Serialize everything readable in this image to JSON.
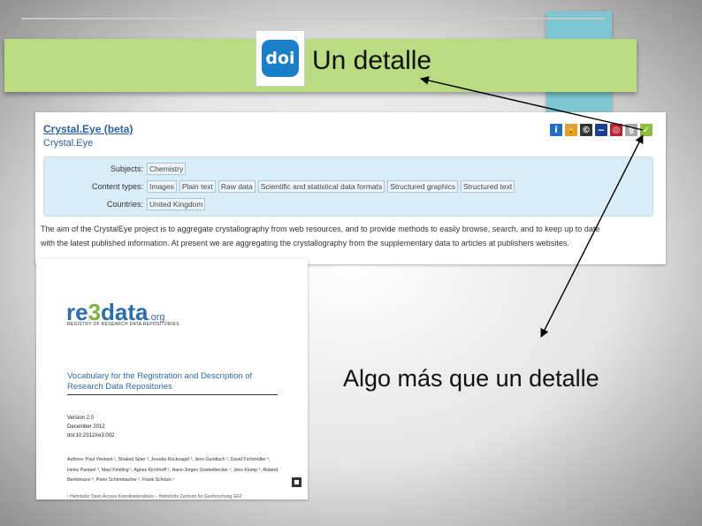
{
  "banner": {
    "logo_text": "doi",
    "title": "Un detalle"
  },
  "repository": {
    "title": "Crystal.Eye (beta)",
    "subtitle": "Crystal.Eye",
    "icons": [
      "info-icon",
      "open-access-icon",
      "copyright-icon",
      "api-icon",
      "policy-icon",
      "certificate-icon",
      "checkmark-icon"
    ],
    "rows": [
      {
        "label": "Subjects:",
        "tags": [
          "Chemistry"
        ]
      },
      {
        "label": "Content types:",
        "tags": [
          "Images",
          "Plain text",
          "Raw data",
          "Scientific and statistical data formats",
          "Structured graphics",
          "Structured text"
        ]
      },
      {
        "label": "Countries:",
        "tags": [
          "United Kingdom"
        ]
      }
    ],
    "description_line1": "The aim of the CrystalEye project is to aggregate crystallography from web resources, and to provide methods to easily browse, search, and to keep up to date",
    "description_line2": "with the latest published information. At present we are aggregating the crystallography from the supplementary data to articles at publishers websites."
  },
  "document": {
    "logo_a": "re",
    "logo_b": "3",
    "logo_c": "data",
    "logo_suffix": ".org",
    "tagline": "REGISTRY OF RESEARCH DATA REPOSITORIES",
    "title": "Vocabulary for the Registration and Description of Research Data Repositories",
    "version": "Version 2.0",
    "date": "December 2012",
    "doi": "doi:10.2312/re3.002",
    "authors": "Authors: Paul Vierkant ¹, Shaked Spier ², Jessika Rücknagel ², Jens Gundlach ¹, David Fichtmüller ³, Heinz Pampel ⁴, Maxi Kindling ¹, Agnes Kirchhoff ⁵, Hans-Jürgen Goebelbecker ¹, Jens Klump ⁶, Roland Bertelmann ⁶, Peter Schirmbacher ², Frank Scholze ¹",
    "footer": "¹ Helmholtz Open Access Koordinationsbüro – Helmholtz-Zentrum für Geoforschung GFZ"
  },
  "bottom_label": "Algo más que un detalle",
  "colors": {
    "banner": "#b8dc7f",
    "teal": "#7ec6d2",
    "doi_blue": "#1a7fca",
    "link_blue": "#2a62a8",
    "panel": "#d9edf8",
    "re3_green": "#7ab43c"
  }
}
